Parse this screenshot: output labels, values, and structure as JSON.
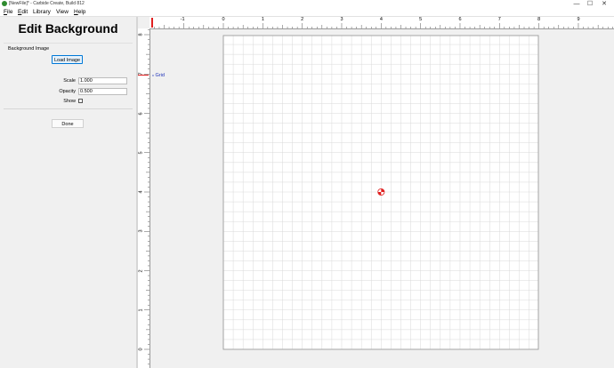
{
  "window": {
    "title": "[NewFile]* - Carbide Create, Build 812",
    "minimize_glyph": "—",
    "maximize_glyph": "☐",
    "close_glyph": "✕"
  },
  "menu": [
    {
      "label": "File",
      "ul": "F",
      "rest": "ile"
    },
    {
      "label": "Edit",
      "ul": "E",
      "rest": "dit"
    },
    {
      "label": "Library",
      "ul": "",
      "rest": "Library"
    },
    {
      "label": "View",
      "ul": "",
      "rest": "View"
    },
    {
      "label": "Help",
      "ul": "H",
      "rest": "elp"
    }
  ],
  "panel": {
    "title": "Edit Background",
    "section_label": "Background Image",
    "load_button": "Load Image",
    "scale_label": "Scale",
    "scale_value": "1.000",
    "opacity_label": "Opacity",
    "opacity_value": "0.500",
    "show_label": "Show",
    "show_checked": false,
    "done_button": "Done"
  },
  "canvas": {
    "grid_toggle_label": "Grid",
    "grid_toggle_caret": "v",
    "ruler_x_labels": [
      "-1",
      "0",
      "1",
      "2",
      "3",
      "4",
      "5",
      "6",
      "7",
      "8",
      "9"
    ],
    "ruler_y_labels": [
      "8",
      "7",
      "6",
      "5",
      "4",
      "3",
      "2",
      "1",
      "0"
    ],
    "origin_marker_color": "#e02020",
    "grid_color": "#d9d9d9",
    "board_border_color": "#a0a0a0"
  }
}
